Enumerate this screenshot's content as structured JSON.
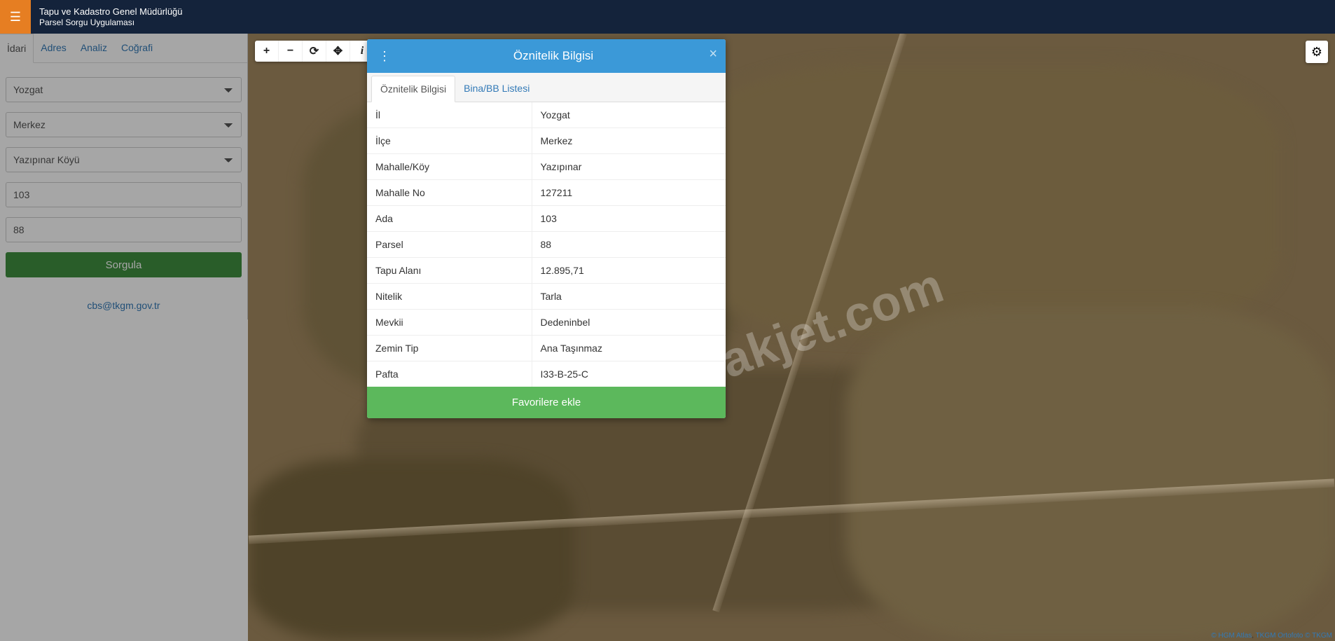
{
  "header": {
    "line1": "Tapu ve Kadastro Genel Müdürlüğü",
    "line2": "Parsel Sorgu Uygulaması"
  },
  "sidebar": {
    "tabs": [
      {
        "label": "İdari",
        "active": true
      },
      {
        "label": "Adres",
        "active": false
      },
      {
        "label": "Analiz",
        "active": false
      },
      {
        "label": "Coğrafi",
        "active": false
      }
    ],
    "fields": {
      "il": "Yozgat",
      "ilce": "Merkez",
      "koy": "Yazıpınar Köyü",
      "ada": "103",
      "parsel": "88"
    },
    "query_button": "Sorgula",
    "footer_email": "cbs@tkgm.gov.tr"
  },
  "map": {
    "watermark": "emlakjet.com",
    "attribution": {
      "hgm": "© HGM Atlas",
      "tkgm": " TKGM Ortofoto © TKGM"
    }
  },
  "modal": {
    "title": "Öznitelik Bilgisi",
    "tabs": [
      {
        "label": "Öznitelik Bilgisi",
        "active": true
      },
      {
        "label": "Bina/BB Listesi",
        "active": false
      }
    ],
    "rows": [
      {
        "k": "İl",
        "v": "Yozgat"
      },
      {
        "k": "İlçe",
        "v": "Merkez"
      },
      {
        "k": "Mahalle/Köy",
        "v": "Yazıpınar"
      },
      {
        "k": "Mahalle No",
        "v": "127211"
      },
      {
        "k": "Ada",
        "v": "103"
      },
      {
        "k": "Parsel",
        "v": "88"
      },
      {
        "k": "Tapu Alanı",
        "v": "12.895,71"
      },
      {
        "k": "Nitelik",
        "v": "Tarla"
      },
      {
        "k": "Mevkii",
        "v": "Dedeninbel"
      },
      {
        "k": "Zemin Tip",
        "v": "Ana Taşınmaz"
      },
      {
        "k": "Pafta",
        "v": "I33-B-25-C"
      }
    ],
    "footer_button": "Favorilere ekle"
  }
}
